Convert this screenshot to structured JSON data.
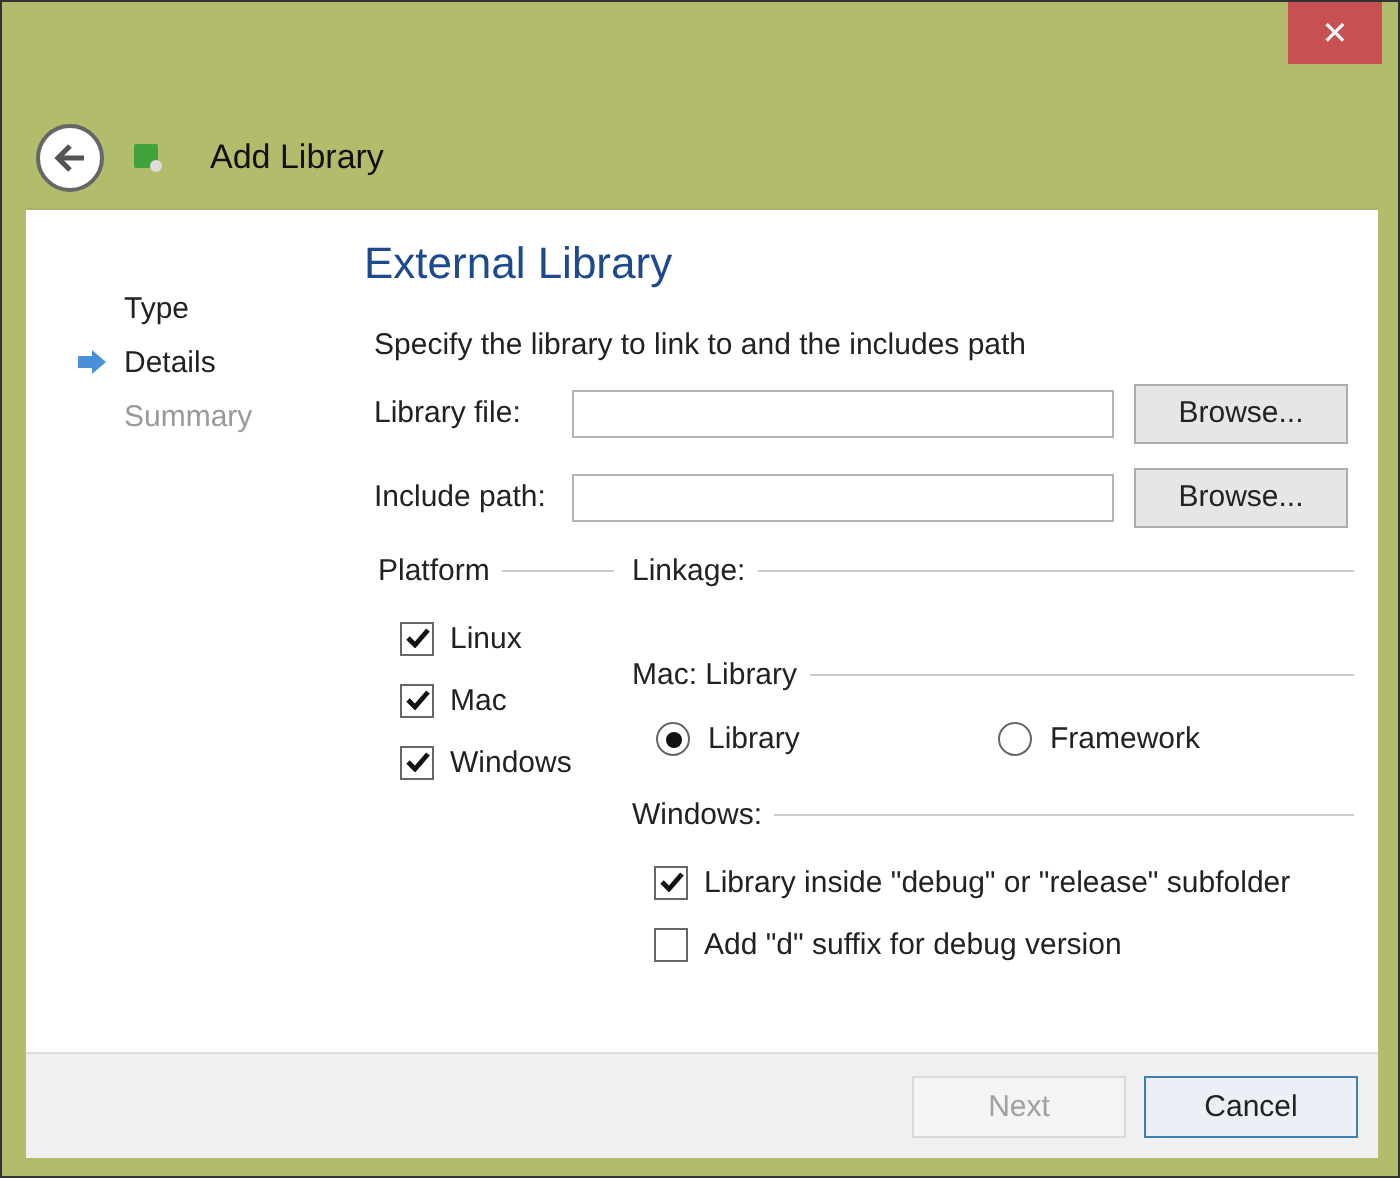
{
  "window": {
    "title": "Add Library",
    "close": "✕"
  },
  "steps": [
    {
      "label": "Type",
      "selected": false,
      "disabled": false
    },
    {
      "label": "Details",
      "selected": true,
      "disabled": false
    },
    {
      "label": "Summary",
      "selected": false,
      "disabled": true
    }
  ],
  "page": {
    "title": "External Library",
    "description": "Specify the library to link to and the includes path"
  },
  "fields": [
    {
      "label": "Library file:",
      "button": "Browse..."
    },
    {
      "label": "Include path:",
      "button": "Browse..."
    }
  ],
  "platform": {
    "title": "Platform",
    "options": [
      {
        "label": "Linux",
        "checked": true
      },
      {
        "label": "Mac",
        "checked": true
      },
      {
        "label": "Windows",
        "checked": true
      }
    ]
  },
  "linkage": {
    "title": "Linkage:"
  },
  "mac": {
    "title": "Mac: Library",
    "options": [
      {
        "label": "Library",
        "selected": true
      },
      {
        "label": "Framework",
        "selected": false
      }
    ]
  },
  "windows": {
    "title": "Windows:",
    "options": [
      {
        "label": "Library inside \"debug\" or \"release\" subfolder",
        "checked": true
      },
      {
        "label": "Add \"d\" suffix for debug version",
        "checked": false
      }
    ]
  },
  "buttons": [
    {
      "label": "Next",
      "disabled": true,
      "default": false
    },
    {
      "label": "Cancel",
      "disabled": false,
      "default": true
    }
  ]
}
